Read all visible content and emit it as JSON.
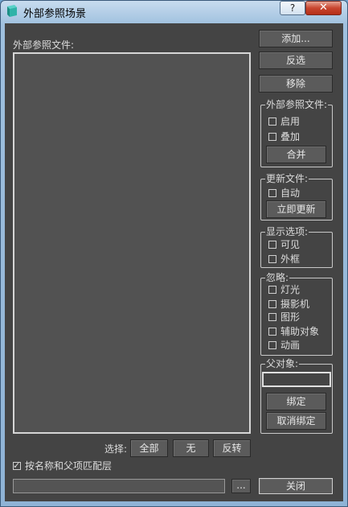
{
  "window": {
    "title": "外部参照场景",
    "help_label": "?",
    "close_label": "✕"
  },
  "file_list": {
    "label": "外部参照文件:"
  },
  "buttons": {
    "add": "添加...",
    "invert_select": "反选",
    "remove": "移除",
    "merge": "合并",
    "update_now": "立即更新",
    "bind": "绑定",
    "unbind": "取消绑定",
    "select_all": "全部",
    "select_none": "无",
    "select_invert": "反转",
    "browse": "...",
    "close": "关闭"
  },
  "xref_group": {
    "title": "外部参照文件:",
    "enabled": {
      "label": "启用",
      "checked": false
    },
    "overlay": {
      "label": "叠加",
      "checked": false
    }
  },
  "update_group": {
    "title": "更新文件:",
    "auto": {
      "label": "自动",
      "checked": false
    }
  },
  "display_group": {
    "title": "显示选项:",
    "visible": {
      "label": "可见",
      "checked": false
    },
    "box": {
      "label": "外框",
      "checked": false
    }
  },
  "ignore_group": {
    "title": "忽略:",
    "items": [
      {
        "label": "灯光",
        "checked": false
      },
      {
        "label": "摄影机",
        "checked": false
      },
      {
        "label": "图形",
        "checked": false
      },
      {
        "label": "辅助对象",
        "checked": false
      },
      {
        "label": "动画",
        "checked": false
      }
    ]
  },
  "parent_group": {
    "title": "父对象:",
    "value": ""
  },
  "selection": {
    "label": "选择:"
  },
  "match_option": {
    "label": "按名称和父项匹配层",
    "checked": true
  },
  "path": {
    "value": ""
  },
  "colors": {
    "panel_bg": "#444444",
    "title_bar": "#9fc0de",
    "close_red": "#c8452f"
  }
}
